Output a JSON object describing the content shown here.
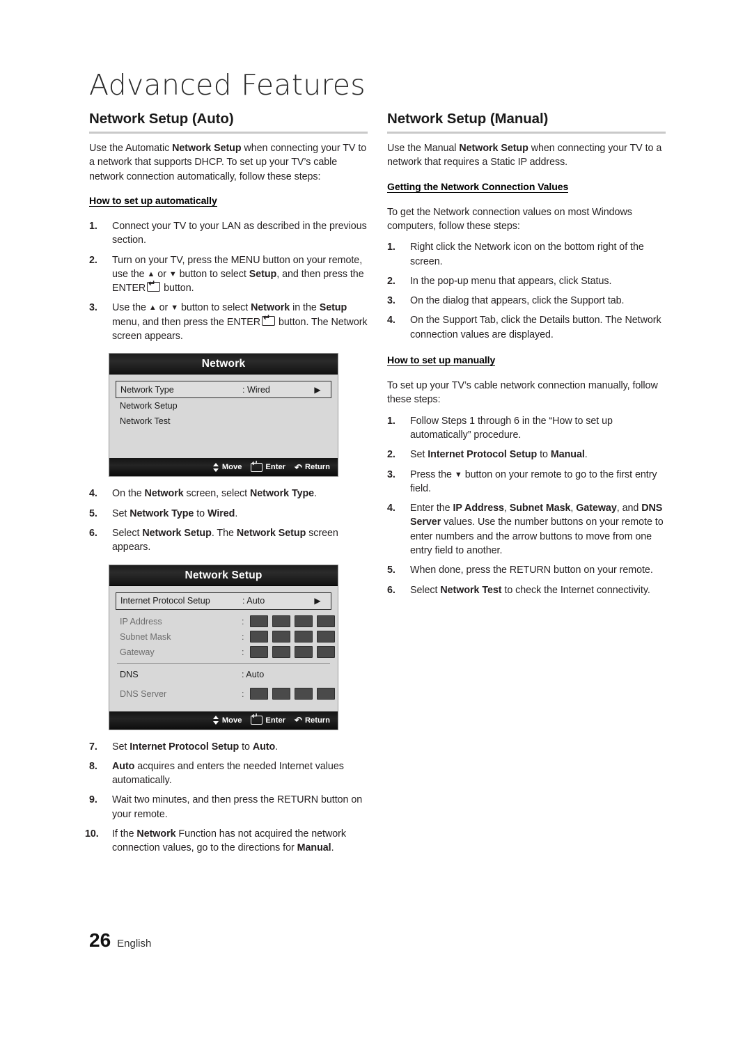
{
  "chapter": {
    "title": "Advanced Features"
  },
  "left": {
    "heading": "Network Setup (Auto)",
    "intro": "Use the Automatic <b>Network Setup</b> when connecting your TV to a network that supports DHCP. To set up your TV’s cable network connection automatically, follow these steps:",
    "sub_heading": "How to set up automatically",
    "steps_a": [
      {
        "num": "1.",
        "html": "Connect your TV to your LAN as described in the previous section."
      },
      {
        "num": "2.",
        "html": "Turn on your TV, press the MENU button on your remote, use the <span class=\"arr\">▲</span> or <span class=\"arr\">▼</span> button to select <b>Setup</b>, and then press the ENTER<span class=\"enterkey\"></span> button."
      },
      {
        "num": "3.",
        "html": "Use the <span class=\"arr\">▲</span> or <span class=\"arr\">▼</span> button to select <b>Network</b> in the <b>Setup</b> menu, and then press the ENTER<span class=\"enterkey\"></span> button. The Network screen appears."
      }
    ],
    "steps_b": [
      {
        "num": "4.",
        "html": "On the <b>Network</b> screen, select <b>Network Type</b>."
      },
      {
        "num": "5.",
        "html": "Set <b>Network Type</b> to <b>Wired</b>."
      },
      {
        "num": "6.",
        "html": "Select <b>Network Setup</b>. The <b>Network Setup</b> screen appears."
      }
    ],
    "steps_c": [
      {
        "num": "7.",
        "html": "Set <b>Internet Protocol Setup</b> to <b>Auto</b>."
      },
      {
        "num": "8.",
        "html": "<b>Auto</b> acquires and enters the needed Internet values automatically."
      },
      {
        "num": "9.",
        "html": "Wait two minutes, and then press the  RETURN button on your remote."
      },
      {
        "num": "10.",
        "html": "If the <b>Network</b> Function has not acquired the network connection values, go to the directions for <b>Manual</b>."
      }
    ]
  },
  "right": {
    "heading": "Network Setup (Manual)",
    "intro": "Use the Manual <b>Network Setup</b> when connecting your TV to a network that requires a Static IP address.",
    "sub_heading_1": "Getting the Network Connection Values",
    "intro_2": "To get the Network connection values on most Windows computers, follow these steps:",
    "steps_a": [
      {
        "num": "1.",
        "html": "Right click the Network icon on the bottom right of the screen."
      },
      {
        "num": "2.",
        "html": "In the pop-up menu that appears, click Status."
      },
      {
        "num": "3.",
        "html": "On the dialog that appears, click the Support tab."
      },
      {
        "num": "4.",
        "html": "On the Support Tab, click the Details button. The Network connection values are displayed."
      }
    ],
    "sub_heading_2": "How to set up manually",
    "intro_3": "To set up your TV’s cable network connection manually, follow these steps:",
    "steps_b": [
      {
        "num": "1.",
        "html": "Follow Steps 1 through 6 in the “How to set up automatically” procedure."
      },
      {
        "num": "2.",
        "html": "Set <b>Internet Protocol Setup</b> to <b>Manual</b>."
      },
      {
        "num": "3.",
        "html": "Press the <span class=\"arr\">▼</span> button on your remote to go to the first entry field."
      },
      {
        "num": "4.",
        "html": "Enter the <b>IP Address</b>, <b>Subnet Mask</b>, <b>Gateway</b>, and <b>DNS Server</b> values. Use the number buttons on your remote to enter numbers and the arrow buttons to move from one entry field to another."
      },
      {
        "num": "5.",
        "html": "When done, press the RETURN button on your remote."
      },
      {
        "num": "6.",
        "html": "Select <b>Network Test</b> to check the Internet connectivity."
      }
    ]
  },
  "osd_network": {
    "title": "Network",
    "rows": [
      {
        "label": "Network Type",
        "value": ": Wired",
        "selected": true,
        "caret": "▶"
      },
      {
        "label": "Network Setup",
        "value": "",
        "selected": false,
        "caret": ""
      },
      {
        "label": "Network Test",
        "value": "",
        "selected": false,
        "caret": ""
      }
    ],
    "footer": {
      "move": "Move",
      "enter": "Enter",
      "return": "Return"
    }
  },
  "osd_network_setup": {
    "title": "Network Setup",
    "row_ip_setup": {
      "label": "Internet Protocol Setup",
      "value": ": Auto",
      "caret": "▶"
    },
    "value_rows": [
      {
        "label": "IP Address",
        "boxes": 4
      },
      {
        "label": "Subnet Mask",
        "boxes": 4
      },
      {
        "label": "Gateway",
        "boxes": 4
      }
    ],
    "row_dns": {
      "label": "DNS",
      "value": ": Auto"
    },
    "row_dns_server": {
      "label": "DNS Server",
      "boxes": 4
    },
    "footer": {
      "move": "Move",
      "enter": "Enter",
      "return": "Return"
    }
  },
  "footer": {
    "page_number": "26",
    "language": "English"
  }
}
